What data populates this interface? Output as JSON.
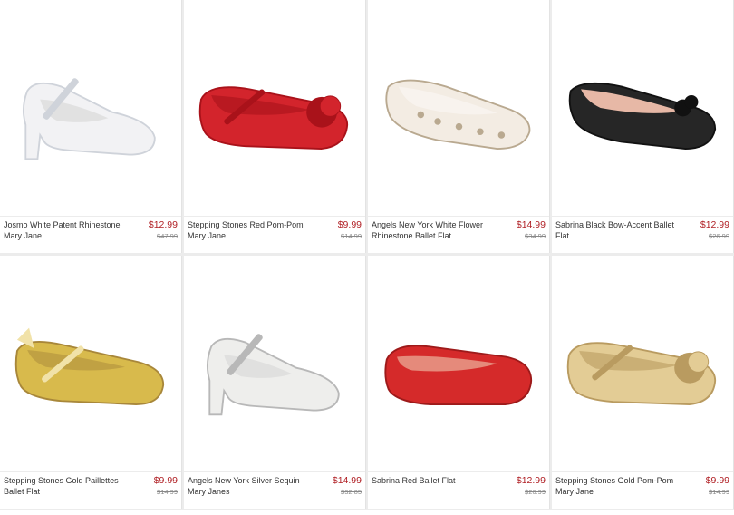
{
  "products": [
    {
      "name": "Josmo White Patent Rhinestone Mary Jane",
      "price": "$12.99",
      "original_price": "$47.99",
      "shoe_color": "#f2f2f4",
      "accent": "#cfd3da",
      "style": "heel-strap"
    },
    {
      "name": "Stepping Stones Red Pom-Pom Mary Jane",
      "price": "$9.99",
      "original_price": "$14.99",
      "shoe_color": "#d3242c",
      "accent": "#a9121a",
      "style": "flat-pompom"
    },
    {
      "name": "Angels New York White Flower Rhinestone Ballet Flat",
      "price": "$14.99",
      "original_price": "$34.99",
      "shoe_color": "#f3ece3",
      "accent": "#b9a990",
      "style": "flat-jewel"
    },
    {
      "name": "Sabrina Black Bow-Accent Ballet Flat",
      "price": "$12.99",
      "original_price": "$26.99",
      "shoe_color": "#262626",
      "accent": "#111111",
      "style": "flat-bow"
    },
    {
      "name": "Stepping Stones Gold Paillettes Ballet Flat",
      "price": "$9.99",
      "original_price": "$14.99",
      "shoe_color": "#d8ba4c",
      "accent": "#a8873a",
      "style": "flat-strap-bow"
    },
    {
      "name": "Angels New York Silver Sequin Mary Janes",
      "price": "$14.99",
      "original_price": "$32.85",
      "shoe_color": "#eeeeec",
      "accent": "#b8b8b8",
      "style": "heel-strap"
    },
    {
      "name": "Sabrina Red Ballet Flat",
      "price": "$12.99",
      "original_price": "$26.99",
      "shoe_color": "#d52a2a",
      "accent": "#9d1a1a",
      "style": "flat-plain"
    },
    {
      "name": "Stepping Stones Gold Pom-Pom Mary Jane",
      "price": "$9.99",
      "original_price": "$14.99",
      "shoe_color": "#e3cc95",
      "accent": "#b99b60",
      "style": "flat-pompom"
    }
  ]
}
